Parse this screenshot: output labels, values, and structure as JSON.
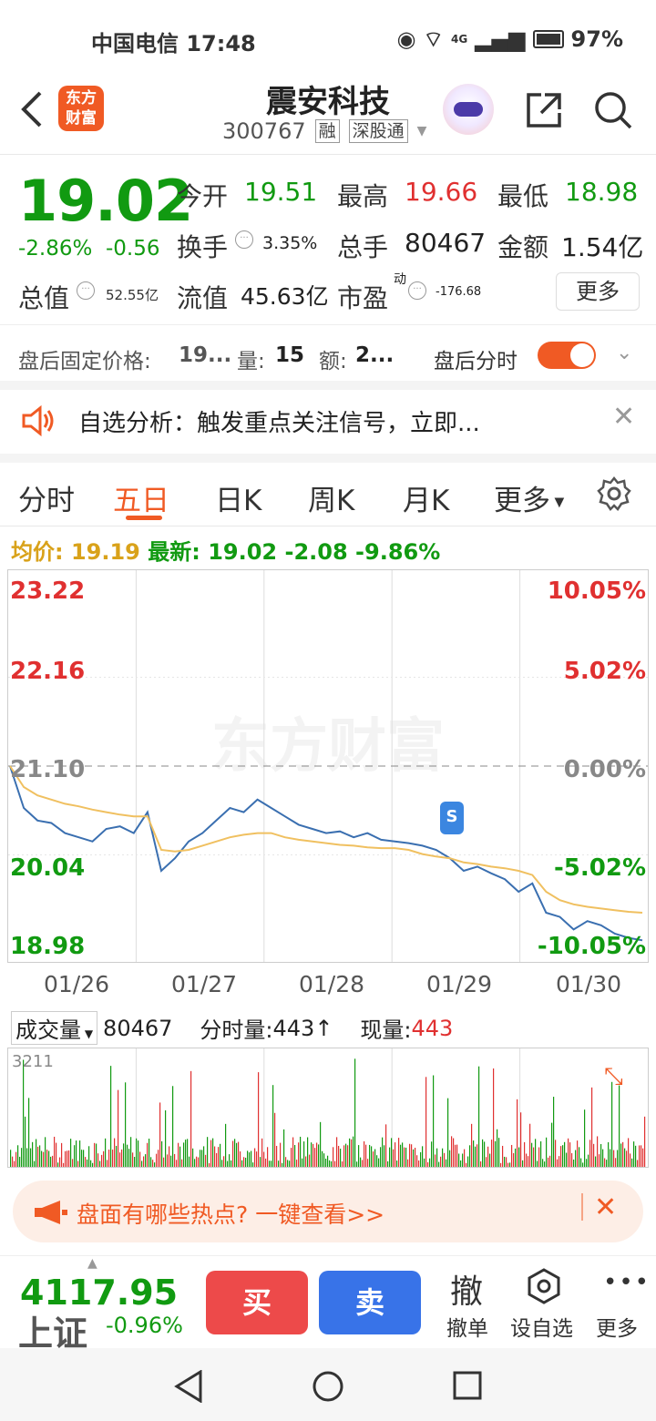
{
  "status": {
    "carrier_time": "中国电信 17:48",
    "network": "4G",
    "battery": "97%"
  },
  "header": {
    "logo_line1": "东方",
    "logo_line2": "财富",
    "title": "震安科技",
    "code": "300767",
    "tag1": "融",
    "tag2": "深股通"
  },
  "quote": {
    "price": "19.02",
    "change_pct": "-2.86%",
    "change": "-0.56",
    "open_label": "今开",
    "open": "19.51",
    "high_label": "最高",
    "high": "19.66",
    "low_label": "最低",
    "low": "18.98",
    "turnover_label": "换手",
    "turnover": "3.35%",
    "vol_label": "总手",
    "vol": "80467",
    "amount_label": "金额",
    "amount": "1.54亿",
    "mcap_label": "总值",
    "mcap": "52.55亿",
    "float_label": "流值",
    "float": "45.63亿",
    "pe_label": "市盈",
    "pe_sup": "动",
    "pe": "-176.68",
    "more": "更多"
  },
  "after_hours": {
    "label": "盘后固定价格:",
    "price": "19...",
    "vol_label": "量:",
    "vol": "15",
    "amt_label": "额:",
    "amt": "2...",
    "toggle_label": "盘后分时"
  },
  "analysis": {
    "text": "自选分析：触发重点关注信号，立即..."
  },
  "tabs": [
    "分时",
    "五日",
    "日K",
    "周K",
    "月K",
    "更多"
  ],
  "infoline": {
    "avg_label": "均价:",
    "avg": "19.19",
    "latest_label": "最新:",
    "latest": "19.02",
    "chg": "-2.08",
    "pct": "-9.86%"
  },
  "chart_data": {
    "type": "line",
    "y_left": [
      "23.22",
      "22.16",
      "21.10",
      "20.04",
      "18.98"
    ],
    "y_right": [
      "10.05%",
      "5.02%",
      "0.00%",
      "-5.02%",
      "-10.05%"
    ],
    "dates": [
      "01/26",
      "01/27",
      "01/28",
      "01/29",
      "01/30"
    ],
    "ylim": [
      18.98,
      23.22
    ],
    "series": [
      {
        "values": [
          21.1,
          20.6,
          20.45,
          20.42,
          20.3,
          20.25,
          20.2,
          20.35,
          20.38,
          20.3,
          20.55,
          19.85,
          20.0,
          20.2,
          20.3,
          20.45,
          20.6,
          20.55,
          20.7,
          20.6,
          20.5,
          20.4,
          20.35,
          20.3,
          20.32,
          20.25,
          20.3,
          20.22,
          20.2,
          20.18,
          20.15,
          20.1,
          20.0,
          19.85,
          19.9,
          19.82,
          19.75,
          19.6,
          19.7,
          19.35,
          19.3,
          19.15,
          19.25,
          19.2,
          19.1,
          19.05,
          19.02
        ]
      },
      {
        "values": [
          21.1,
          20.85,
          20.75,
          20.7,
          20.65,
          20.62,
          20.58,
          20.55,
          20.52,
          20.5,
          20.5,
          20.1,
          20.08,
          20.1,
          20.15,
          20.2,
          20.25,
          20.28,
          20.3,
          20.3,
          20.25,
          20.22,
          20.2,
          20.18,
          20.16,
          20.15,
          20.13,
          20.12,
          20.12,
          20.1,
          20.05,
          20.02,
          20.0,
          19.95,
          19.93,
          19.9,
          19.88,
          19.85,
          19.8,
          19.6,
          19.5,
          19.45,
          19.42,
          19.4,
          19.38,
          19.36,
          19.35
        ]
      }
    ]
  },
  "volume": {
    "label": "成交量",
    "total": "80467",
    "tick_label": "分时量:",
    "tick": "443",
    "now_label": "现量:",
    "now": "443",
    "max": "3211"
  },
  "hot": {
    "text": "盘面有哪些热点? 一键查看>>"
  },
  "bottom": {
    "index": "4117.95",
    "index_name": "上证",
    "index_chg": "-0.96%",
    "buy": "买",
    "sell": "卖",
    "cancel_icon": "撤",
    "cancel": "撤单",
    "watch": "设自选",
    "more": "更多"
  },
  "colors": {
    "brand": "#f05a24",
    "up": "#e03030",
    "down": "#119a11",
    "avg": "#f0c060",
    "line": "#3a6fb0"
  }
}
